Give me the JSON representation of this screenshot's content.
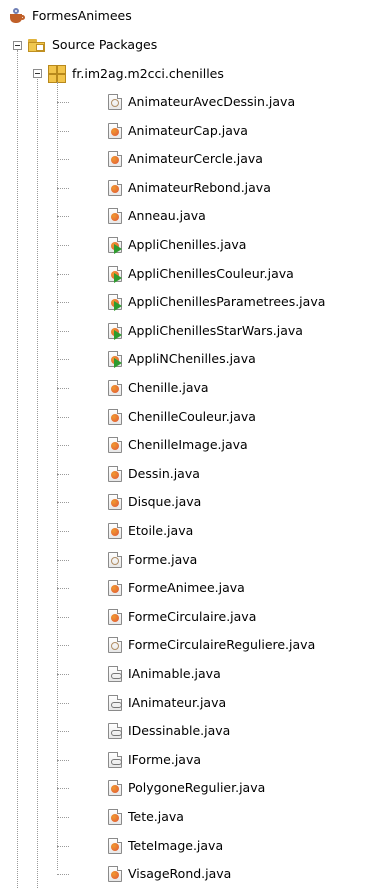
{
  "project": {
    "name": "FormesAnimees",
    "icon": "java-project-cup-icon"
  },
  "source_packages": {
    "label": "Source Packages",
    "icon": "source-folder-icon"
  },
  "package": {
    "name": "fr.im2ag.m2cci.chenilles",
    "icon": "package-icon"
  },
  "files": [
    {
      "name": "AnimateurAvecDessin.java",
      "kind": "abstract"
    },
    {
      "name": "AnimateurCap.java",
      "kind": "class"
    },
    {
      "name": "AnimateurCercle.java",
      "kind": "class"
    },
    {
      "name": "AnimateurRebond.java",
      "kind": "class"
    },
    {
      "name": "Anneau.java",
      "kind": "class"
    },
    {
      "name": "AppliChenilles.java",
      "kind": "main"
    },
    {
      "name": "AppliChenillesCouleur.java",
      "kind": "main"
    },
    {
      "name": "AppliChenillesParametrees.java",
      "kind": "main"
    },
    {
      "name": "AppliChenillesStarWars.java",
      "kind": "main"
    },
    {
      "name": "AppliNChenilles.java",
      "kind": "main"
    },
    {
      "name": "Chenille.java",
      "kind": "class"
    },
    {
      "name": "ChenilleCouleur.java",
      "kind": "class"
    },
    {
      "name": "ChenilleImage.java",
      "kind": "class"
    },
    {
      "name": "Dessin.java",
      "kind": "class"
    },
    {
      "name": "Disque.java",
      "kind": "class"
    },
    {
      "name": "Etoile.java",
      "kind": "class"
    },
    {
      "name": "Forme.java",
      "kind": "abstract"
    },
    {
      "name": "FormeAnimee.java",
      "kind": "class"
    },
    {
      "name": "FormeCirculaire.java",
      "kind": "class"
    },
    {
      "name": "FormeCirculaireReguliere.java",
      "kind": "abstract"
    },
    {
      "name": "IAnimable.java",
      "kind": "interface"
    },
    {
      "name": "IAnimateur.java",
      "kind": "interface"
    },
    {
      "name": "IDessinable.java",
      "kind": "interface"
    },
    {
      "name": "IForme.java",
      "kind": "interface"
    },
    {
      "name": "PolygoneRegulier.java",
      "kind": "class"
    },
    {
      "name": "Tete.java",
      "kind": "class"
    },
    {
      "name": "TeteImage.java",
      "kind": "class"
    },
    {
      "name": "VisageRond.java",
      "kind": "class"
    }
  ],
  "colors": {
    "class_mark": "#e0553a",
    "class_mark_alt": "#f09a2e",
    "main_mark": "#2e9b2e",
    "interface_mark": "#777777"
  }
}
